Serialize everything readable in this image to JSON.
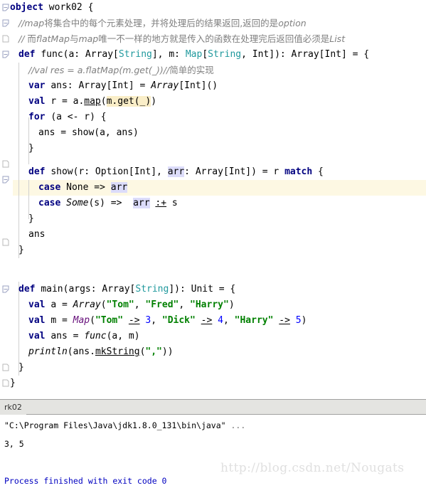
{
  "editor": {
    "language": "scala",
    "colors": {
      "keyword": "#000080",
      "type": "#20999d",
      "string": "#008000",
      "number": "#0000ff",
      "comment": "#808080",
      "class_italic": "#660e7a",
      "caret_line_bg": "#fdf8e3",
      "search_highlight_bg": "#faeec8",
      "identifier_highlight_bg": "#dcdcfa",
      "console_cmd_bg": "#e6f2e6",
      "console_exit": "#0000c0"
    },
    "lines": [
      {
        "n": 1,
        "indent": 0,
        "fold": "open",
        "text": "object work02 {"
      },
      {
        "n": 2,
        "indent": 1,
        "fold": "open",
        "text": "//map将集合中的每个元素处理，并将处理后的结果返回,返回的是option"
      },
      {
        "n": 3,
        "indent": 1,
        "fold": "doc",
        "text": "// 而flatMap与map唯一不一样的地方就是传入的函数在处理完后返回值必须是List"
      },
      {
        "n": 4,
        "indent": 1,
        "fold": "open",
        "text": "def func(a: Array[String], m: Map[String, Int]): Array[Int] = {"
      },
      {
        "n": 5,
        "indent": 2,
        "fold": "",
        "text": "//val res = a.flatMap(m.get(_))//简单的实现"
      },
      {
        "n": 6,
        "indent": 2,
        "fold": "",
        "text": "var ans: Array[Int] = Array[Int]()"
      },
      {
        "n": 7,
        "indent": 2,
        "fold": "",
        "text": "val r = a.map(m.get(_))"
      },
      {
        "n": 8,
        "indent": 2,
        "fold": "",
        "text": "for (a <- r) {"
      },
      {
        "n": 9,
        "indent": 3,
        "fold": "",
        "text": "ans = show(a, ans)"
      },
      {
        "n": 10,
        "indent": 2,
        "fold": "",
        "text": "}"
      },
      {
        "n": 11,
        "indent": 2,
        "fold": "open",
        "text": "def show(r: Option[Int], arr: Array[Int]) = r match {"
      },
      {
        "n": 12,
        "indent": 3,
        "fold": "",
        "text": "case None => arr"
      },
      {
        "n": 13,
        "indent": 3,
        "fold": "",
        "text": "case Some(s) =>  arr :+ s"
      },
      {
        "n": 14,
        "indent": 2,
        "fold": "",
        "text": "}"
      },
      {
        "n": 15,
        "indent": 2,
        "fold": "",
        "text": "ans"
      },
      {
        "n": 16,
        "indent": 1,
        "fold": "doc",
        "text": "}"
      },
      {
        "n": 17,
        "indent": 0,
        "fold": "",
        "text": ""
      },
      {
        "n": 18,
        "indent": 1,
        "fold": "open",
        "text": "def main(args: Array[String]): Unit = {"
      },
      {
        "n": 19,
        "indent": 2,
        "fold": "",
        "text": "val a = Array(\"Tom\", \"Fred\", \"Harry\")"
      },
      {
        "n": 20,
        "indent": 2,
        "fold": "",
        "text": "val m = Map(\"Tom\" -> 3, \"Dick\" -> 4, \"Harry\" -> 5)"
      },
      {
        "n": 21,
        "indent": 2,
        "fold": "",
        "text": "val ans = func(a, m)"
      },
      {
        "n": 22,
        "indent": 2,
        "fold": "",
        "text": "println(ans.mkString(\",\"))"
      },
      {
        "n": 23,
        "indent": 1,
        "fold": "doc",
        "text": "}"
      },
      {
        "n": 24,
        "indent": 0,
        "fold": "doc",
        "text": "}"
      }
    ],
    "caret_line_number": 12,
    "highlighted_tokens": [
      "m.get(_)",
      "arr"
    ]
  },
  "console": {
    "tab_label": "rk02",
    "command_line": "\"C:\\Program Files\\Java\\jdk1.8.0_131\\bin\\java\" ",
    "command_ellipsis": "...",
    "output_line": "3, 5",
    "exit_line": "Process finished with exit code 0"
  },
  "watermark": {
    "text": "http://blog.csdn.net/Nougats"
  }
}
